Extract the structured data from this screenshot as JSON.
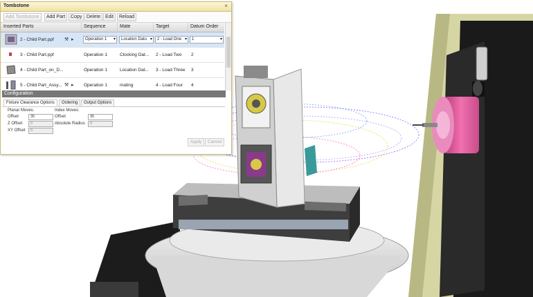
{
  "window": {
    "title": "Tombstone",
    "close_glyph": "×"
  },
  "toolbar": {
    "add_tombstone": "Add Tombstone",
    "add_part": "Add Part",
    "copy": "Copy",
    "delete": "Delete",
    "edit": "Edit",
    "reload": "Reload"
  },
  "grid": {
    "columns": [
      "Inserted Parts",
      "Sequence",
      "Mate",
      "Target",
      "Datum Order"
    ],
    "rows": [
      {
        "part": "2 - Child Part.ppf",
        "sequence": "Operation 1",
        "mate": "Location Datu",
        "target": "2 - Load One",
        "datum": "1"
      },
      {
        "part": "3 - Child Part.ppf",
        "sequence": "Operation 1",
        "mate": "Clocking Dat...",
        "target": "2 - Load Two",
        "datum": "2"
      },
      {
        "part": "4 - Child Part_on_D...",
        "sequence": "Operation 1",
        "mate": "Location Dat...",
        "target": "3 - Load Three",
        "datum": "3"
      },
      {
        "part": "5 - Child Part_Assy...",
        "sequence": "Operation 1",
        "mate": "mating",
        "target": "4 - Load Four",
        "datum": "4"
      }
    ]
  },
  "config": {
    "header": "Configuration",
    "tabs": [
      "Fixture Clearance Options",
      "Ordering",
      "Output Options"
    ],
    "planar_label": "Planar Moves:",
    "offset_label": "Offset",
    "offset_value": "35",
    "z_offset_label": "Z Offset",
    "z_offset_value": "0",
    "xy_offset_label": "XY Offset",
    "xy_offset_value": "0",
    "index_label": "Index Moves:",
    "index_offset_label": "Offset",
    "index_offset_value": "35",
    "abs_radius_label": "Absolute Radius",
    "abs_radius_value": "0",
    "apply": "Apply",
    "cancel": "Cancel"
  },
  "icons": [
    "close-icon",
    "dropdown-arrow-icon",
    "clamp-icon",
    "arrow-right-icon"
  ],
  "colors": {
    "accent": "#efe2a6",
    "selected_row": "#d7e6f7",
    "spindle": "#e0559a",
    "machine_wall": "#d6d6a4"
  }
}
